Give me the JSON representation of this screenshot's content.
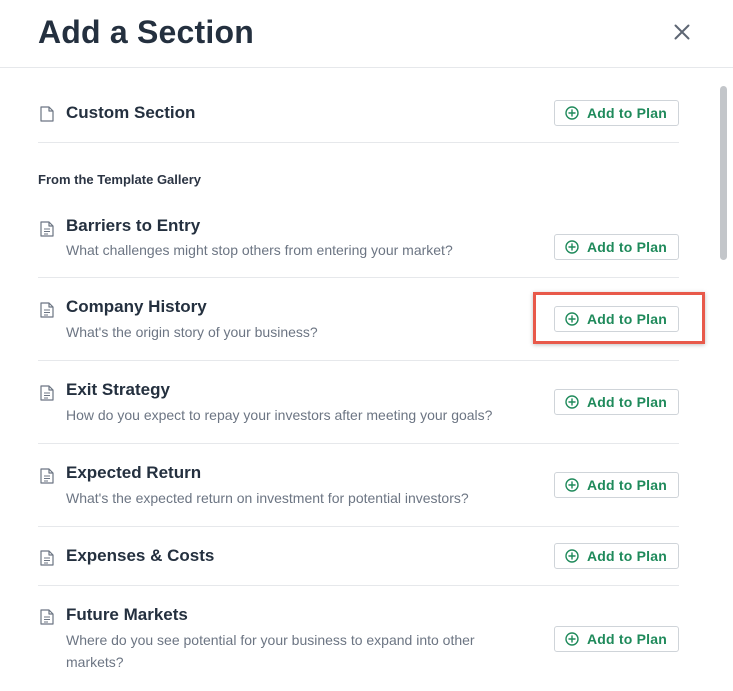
{
  "modal": {
    "title": "Add a Section",
    "close_icon": "close-icon"
  },
  "custom": {
    "title": "Custom Section",
    "button_label": "Add to Plan"
  },
  "gallery": {
    "heading": "From the Template Gallery",
    "items": [
      {
        "title": "Barriers to Entry",
        "desc": "What challenges might stop others from entering your market?",
        "button_label": "Add to Plan"
      },
      {
        "title": "Company History",
        "desc": "What's the origin story of your business?",
        "button_label": "Add to Plan",
        "highlighted": true
      },
      {
        "title": "Exit Strategy",
        "desc": "How do you expect to repay your investors after meeting your goals?",
        "button_label": "Add to Plan"
      },
      {
        "title": "Expected Return",
        "desc": "What's the expected return on investment for potential investors?",
        "button_label": "Add to Plan"
      },
      {
        "title": "Expenses & Costs",
        "desc": "",
        "button_label": "Add to Plan"
      },
      {
        "title": "Future Markets",
        "desc": "Where do you see potential for your business to expand into other markets?",
        "button_label": "Add to Plan"
      }
    ]
  },
  "colors": {
    "accent_green": "#1f8a5b",
    "highlight_red": "#e8594a",
    "title_text": "#24303f",
    "muted_text": "#6c7583"
  },
  "icons": {
    "item": "document-icon",
    "button": "plus-circle-icon"
  }
}
